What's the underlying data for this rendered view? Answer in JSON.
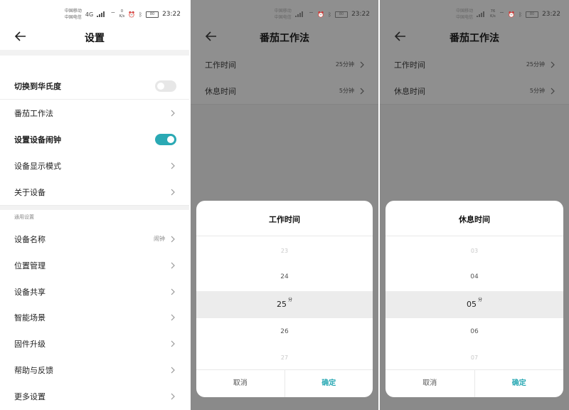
{
  "status": {
    "carrier1": "中国移动",
    "carrier2": "中国电信",
    "net": "4G",
    "speed_value": "0",
    "speed_unit": "K/s",
    "speed2_value": "76",
    "battery": "80",
    "time": "23:22"
  },
  "settings": {
    "title": "设置",
    "items": [
      {
        "label": "切换到华氏度"
      },
      {
        "label": "番茄工作法"
      },
      {
        "label": "设置设备闹钟"
      },
      {
        "label": "设备显示模式"
      },
      {
        "label": "关于设备"
      }
    ],
    "section_label": "通用设置",
    "general": [
      {
        "label": "设备名称",
        "value": "闹钟"
      },
      {
        "label": "位置管理"
      },
      {
        "label": "设备共享"
      },
      {
        "label": "智能场景"
      },
      {
        "label": "固件升级"
      },
      {
        "label": "帮助与反馈"
      },
      {
        "label": "更多设置"
      }
    ],
    "toggles": {
      "fahrenheit": false,
      "alarm": true
    }
  },
  "pomodoro": {
    "title": "番茄工作法",
    "rows": [
      {
        "label": "工作时间",
        "value": "25分钟"
      },
      {
        "label": "休息时间",
        "value": "5分钟"
      }
    ]
  },
  "work_picker": {
    "title": "工作时间",
    "values": [
      "23",
      "24",
      "25",
      "26",
      "27"
    ],
    "unit": "分",
    "cancel": "取消",
    "confirm": "确定"
  },
  "rest_picker": {
    "title": "休息时间",
    "values": [
      "03",
      "04",
      "05",
      "06",
      "07"
    ],
    "unit": "分",
    "cancel": "取消",
    "confirm": "确定"
  },
  "colors": {
    "accent": "#2aa9b4",
    "dim": "#8a8a8a"
  }
}
